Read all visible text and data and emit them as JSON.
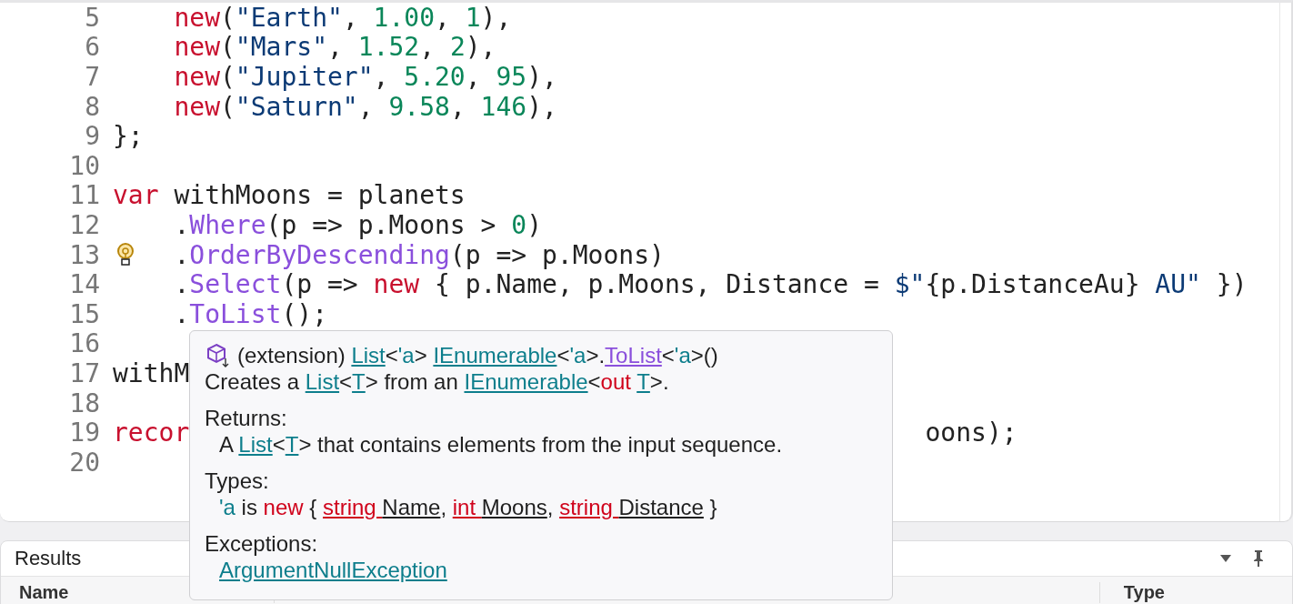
{
  "editor": {
    "lines": [
      {
        "number": "5",
        "hint": false,
        "indent": true,
        "tokens": [
          {
            "kind": "keyword",
            "text": "new"
          },
          {
            "kind": "plain",
            "text": "("
          },
          {
            "kind": "string",
            "text": "\"Earth\""
          },
          {
            "kind": "plain",
            "text": ", "
          },
          {
            "kind": "number",
            "text": "1.00"
          },
          {
            "kind": "plain",
            "text": ", "
          },
          {
            "kind": "number",
            "text": "1"
          },
          {
            "kind": "plain",
            "text": "),"
          }
        ]
      },
      {
        "number": "6",
        "hint": false,
        "indent": true,
        "tokens": [
          {
            "kind": "keyword",
            "text": "new"
          },
          {
            "kind": "plain",
            "text": "("
          },
          {
            "kind": "string",
            "text": "\"Mars\""
          },
          {
            "kind": "plain",
            "text": ", "
          },
          {
            "kind": "number",
            "text": "1.52"
          },
          {
            "kind": "plain",
            "text": ", "
          },
          {
            "kind": "number",
            "text": "2"
          },
          {
            "kind": "plain",
            "text": "),"
          }
        ]
      },
      {
        "number": "7",
        "hint": false,
        "indent": true,
        "tokens": [
          {
            "kind": "keyword",
            "text": "new"
          },
          {
            "kind": "plain",
            "text": "("
          },
          {
            "kind": "string",
            "text": "\"Jupiter\""
          },
          {
            "kind": "plain",
            "text": ", "
          },
          {
            "kind": "number",
            "text": "5.20"
          },
          {
            "kind": "plain",
            "text": ", "
          },
          {
            "kind": "number",
            "text": "95"
          },
          {
            "kind": "plain",
            "text": "),"
          }
        ]
      },
      {
        "number": "8",
        "hint": false,
        "indent": true,
        "tokens": [
          {
            "kind": "keyword",
            "text": "new"
          },
          {
            "kind": "plain",
            "text": "("
          },
          {
            "kind": "string",
            "text": "\"Saturn\""
          },
          {
            "kind": "plain",
            "text": ", "
          },
          {
            "kind": "number",
            "text": "9.58"
          },
          {
            "kind": "plain",
            "text": ", "
          },
          {
            "kind": "number",
            "text": "146"
          },
          {
            "kind": "plain",
            "text": "),"
          }
        ]
      },
      {
        "number": "9",
        "hint": false,
        "indent": false,
        "tokens": [
          {
            "kind": "plain",
            "text": "};"
          }
        ]
      },
      {
        "number": "10",
        "hint": false
      },
      {
        "number": "11",
        "hint": false,
        "indent": false,
        "tokens": [
          {
            "kind": "keyword",
            "text": "var"
          },
          {
            "kind": "plain",
            "text": " withMoons = planets"
          }
        ]
      },
      {
        "number": "12",
        "hint": false,
        "indent": true,
        "tokens": [
          {
            "kind": "plain",
            "text": "."
          },
          {
            "kind": "method",
            "text": "Where"
          },
          {
            "kind": "plain",
            "text": "(p => p.Moons > "
          },
          {
            "kind": "number",
            "text": "0"
          },
          {
            "kind": "plain",
            "text": ")"
          }
        ]
      },
      {
        "number": "13",
        "hint": true,
        "indent": true,
        "tokens": [
          {
            "kind": "plain",
            "text": "."
          },
          {
            "kind": "method",
            "text": "OrderByDescending"
          },
          {
            "kind": "plain",
            "text": "(p => p.Moons)"
          }
        ]
      },
      {
        "number": "14",
        "hint": false,
        "indent": true,
        "tokens": [
          {
            "kind": "plain",
            "text": "."
          },
          {
            "kind": "method",
            "text": "Select"
          },
          {
            "kind": "plain",
            "text": "(p => "
          },
          {
            "kind": "keyword",
            "text": "new"
          },
          {
            "kind": "plain",
            "text": " { p.Name, p.Moons, Distance = "
          },
          {
            "kind": "string",
            "text": "$\""
          },
          {
            "kind": "plain",
            "text": "{p.DistanceAu}"
          },
          {
            "kind": "string",
            "text": " AU\""
          },
          {
            "kind": "plain",
            "text": " })"
          }
        ]
      },
      {
        "number": "15",
        "hint": false,
        "indent": true,
        "tokens": [
          {
            "kind": "plain",
            "text": "."
          },
          {
            "kind": "method",
            "text": "ToList"
          },
          {
            "kind": "plain",
            "text": "();"
          }
        ]
      },
      {
        "number": "16",
        "hint": false
      },
      {
        "number": "17",
        "hint": false,
        "indent": false,
        "tokens": [
          {
            "kind": "plain",
            "text": "withM"
          }
        ]
      },
      {
        "number": "18",
        "hint": false
      },
      {
        "number": "19",
        "hint": false,
        "indent": false,
        "tokens": [
          {
            "kind": "keyword",
            "text": "recor"
          }
        ],
        "tail": [
          {
            "kind": "plain",
            "text": "oons);"
          }
        ]
      },
      {
        "number": "20",
        "hint": false
      }
    ]
  },
  "tooltip": {
    "signature": [
      {
        "kind": "plain",
        "text": "(extension) "
      },
      {
        "kind": "link",
        "text": "List"
      },
      {
        "kind": "plain",
        "text": "<"
      },
      {
        "kind": "typeparam",
        "text": "'a"
      },
      {
        "kind": "plain",
        "text": "> "
      },
      {
        "kind": "link",
        "text": "IEnumerable"
      },
      {
        "kind": "plain",
        "text": "<"
      },
      {
        "kind": "typeparam",
        "text": "'a"
      },
      {
        "kind": "plain",
        "text": ">."
      },
      {
        "kind": "method_link",
        "text": "ToList"
      },
      {
        "kind": "plain",
        "text": "<"
      },
      {
        "kind": "typeparam",
        "text": "'a"
      },
      {
        "kind": "plain",
        "text": ">()"
      }
    ],
    "description": [
      {
        "kind": "plain",
        "text": "Creates a "
      },
      {
        "kind": "link",
        "text": "List"
      },
      {
        "kind": "plain",
        "text": "<"
      },
      {
        "kind": "link",
        "text": "T"
      },
      {
        "kind": "plain",
        "text": "> from an "
      },
      {
        "kind": "link",
        "text": "IEnumerable"
      },
      {
        "kind": "plain",
        "text": "<"
      },
      {
        "kind": "keyword",
        "text": "out "
      },
      {
        "kind": "link",
        "text": "T"
      },
      {
        "kind": "plain",
        "text": ">."
      }
    ],
    "sections": [
      {
        "heading": "Returns:",
        "body": [
          {
            "kind": "plain",
            "text": "A "
          },
          {
            "kind": "link",
            "text": "List"
          },
          {
            "kind": "plain",
            "text": "<"
          },
          {
            "kind": "link",
            "text": "T"
          },
          {
            "kind": "plain",
            "text": "> that contains elements from the input sequence."
          }
        ]
      },
      {
        "heading": "Types:",
        "body": [
          {
            "kind": "typeparam",
            "text": "'a"
          },
          {
            "kind": "plain",
            "text": " is "
          },
          {
            "kind": "keyword",
            "text": "new"
          },
          {
            "kind": "plain",
            "text": " { "
          },
          {
            "kind": "keyword_link",
            "text": "string "
          },
          {
            "kind": "name_link",
            "text": "Name"
          },
          {
            "kind": "plain",
            "text": ", "
          },
          {
            "kind": "keyword_link",
            "text": "int "
          },
          {
            "kind": "name_link",
            "text": "Moons"
          },
          {
            "kind": "plain",
            "text": ", "
          },
          {
            "kind": "keyword_link",
            "text": "string "
          },
          {
            "kind": "name_link",
            "text": "Distance"
          },
          {
            "kind": "plain",
            "text": " }"
          }
        ]
      },
      {
        "heading": "Exceptions:",
        "body": [
          {
            "kind": "link",
            "text": "ArgumentNullException"
          }
        ]
      }
    ]
  },
  "results": {
    "title": "Results",
    "columns": [
      "Name",
      "Type"
    ]
  }
}
